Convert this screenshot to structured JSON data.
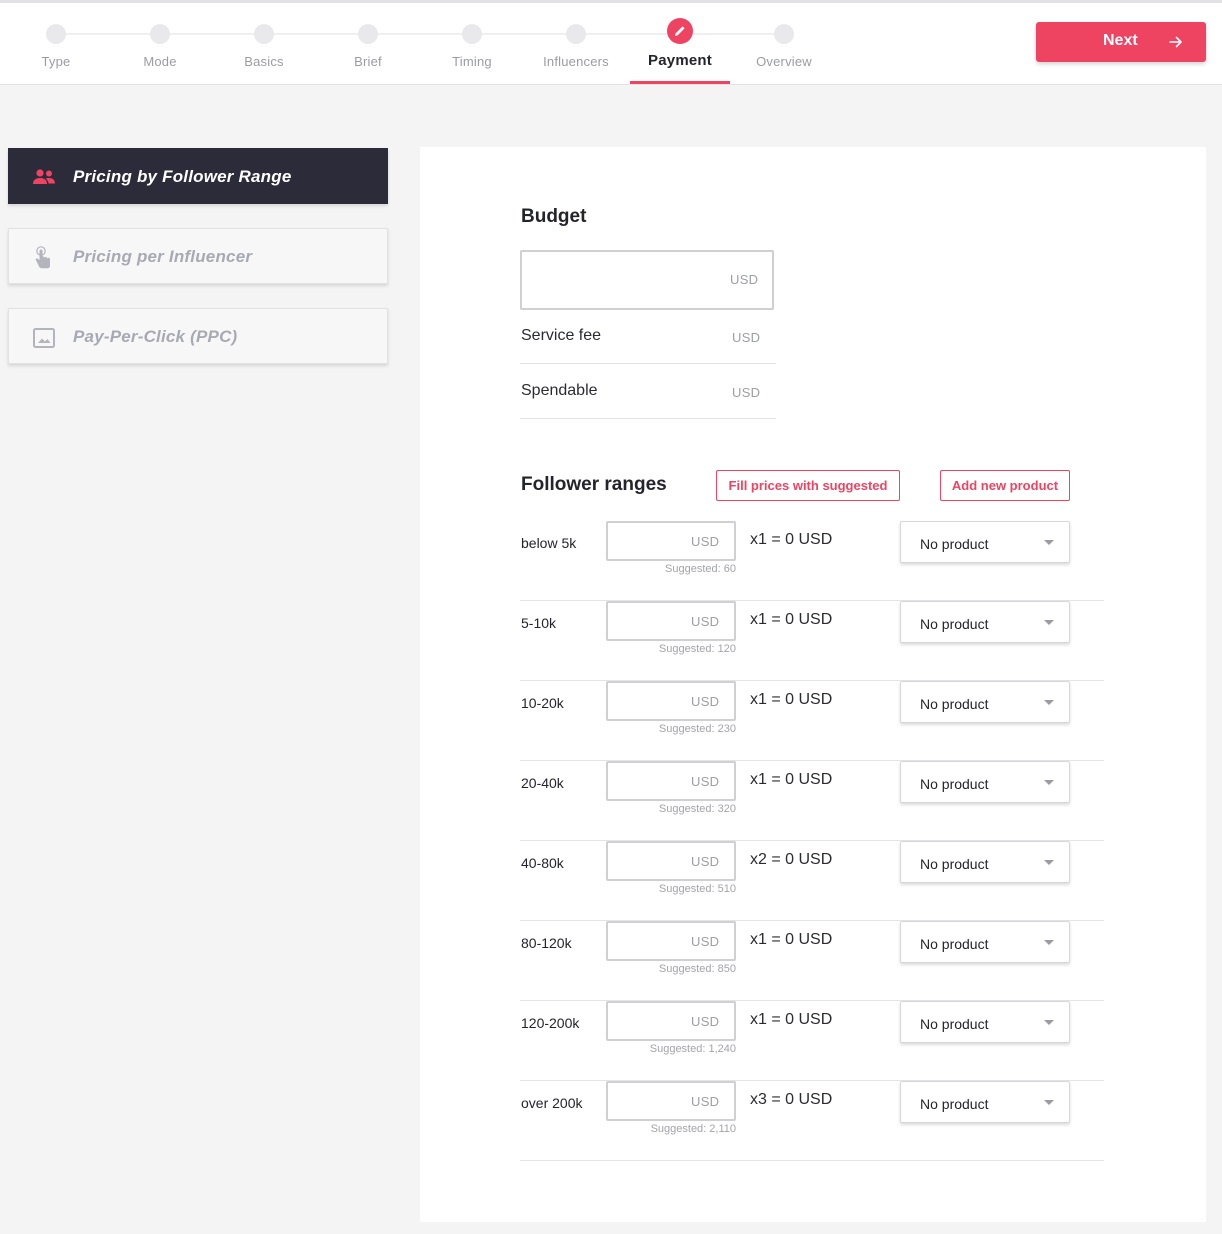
{
  "steps": [
    {
      "label": "Type"
    },
    {
      "label": "Mode"
    },
    {
      "label": "Basics"
    },
    {
      "label": "Brief"
    },
    {
      "label": "Timing"
    },
    {
      "label": "Influencers"
    },
    {
      "label": "Payment",
      "active": true
    },
    {
      "label": "Overview"
    }
  ],
  "next_button": {
    "label": "Next",
    "icon": "arrow-right-icon"
  },
  "sidebar": {
    "tabs": [
      {
        "label": "Pricing by Follower Range",
        "icon": "users-icon",
        "active": true
      },
      {
        "label": "Pricing per Influencer",
        "icon": "hand-pointer-icon"
      },
      {
        "label": "Pay-Per-Click (PPC)",
        "icon": "image-icon"
      }
    ]
  },
  "budget": {
    "title": "Budget",
    "input_value": "",
    "unit": "USD",
    "service_fee": {
      "label": "Service fee",
      "unit": "USD"
    },
    "spendable": {
      "label": "Spendable",
      "unit": "USD"
    }
  },
  "follower_ranges": {
    "title": "Follower ranges",
    "fill_button": "Fill prices with suggested",
    "add_button": "Add new product",
    "unit": "USD",
    "rows": [
      {
        "label": "below 5k",
        "suggested": "Suggested: 60",
        "multiplier": "x1 = 0 USD",
        "product": "No product"
      },
      {
        "label": "5-10k",
        "suggested": "Suggested: 120",
        "multiplier": "x1 = 0 USD",
        "product": "No product"
      },
      {
        "label": "10-20k",
        "suggested": "Suggested: 230",
        "multiplier": "x1 = 0 USD",
        "product": "No product"
      },
      {
        "label": "20-40k",
        "suggested": "Suggested: 320",
        "multiplier": "x1 = 0 USD",
        "product": "No product"
      },
      {
        "label": "40-80k",
        "suggested": "Suggested: 510",
        "multiplier": "x2 = 0 USD",
        "product": "No product"
      },
      {
        "label": "80-120k",
        "suggested": "Suggested: 850",
        "multiplier": "x1 = 0 USD",
        "product": "No product"
      },
      {
        "label": "120-200k",
        "suggested": "Suggested: 1,240",
        "multiplier": "x1 = 0 USD",
        "product": "No product"
      },
      {
        "label": "over 200k",
        "suggested": "Suggested: 2,110",
        "multiplier": "x3 = 0 USD",
        "product": "No product"
      }
    ]
  },
  "colors": {
    "accent": "#ee4462",
    "sidebar_active": "#2b2b3a"
  }
}
